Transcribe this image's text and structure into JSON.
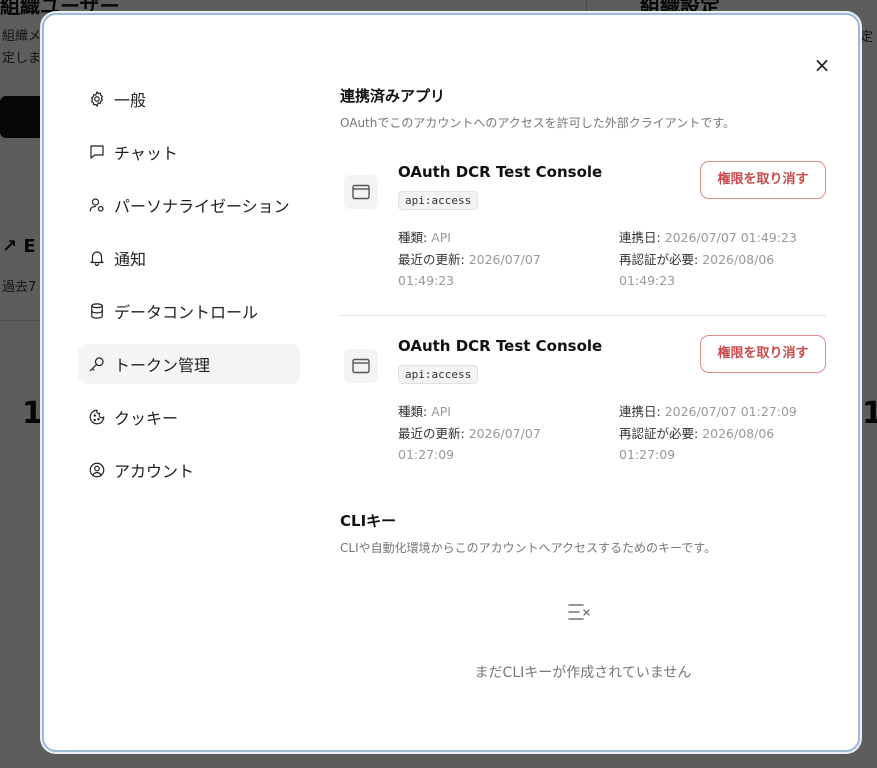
{
  "background": {
    "title_left": "組織ユーザー",
    "title_right": "組織設定",
    "desc_left_1": "組織メ",
    "desc_left_2": "定しま",
    "desc_right": "定",
    "section": "↗ E",
    "section_desc": "過去7",
    "number_left": "1",
    "number_right": "1"
  },
  "modal": {
    "close_label": "×",
    "sidebar": {
      "items": [
        {
          "label": "一般",
          "icon": "gear-icon"
        },
        {
          "label": "チャット",
          "icon": "chat-bubble-icon"
        },
        {
          "label": "パーソナライゼーション",
          "icon": "user-settings-icon"
        },
        {
          "label": "通知",
          "icon": "bell-icon"
        },
        {
          "label": "データコントロール",
          "icon": "database-icon"
        },
        {
          "label": "トークン管理",
          "icon": "key-icon"
        },
        {
          "label": "クッキー",
          "icon": "cookie-icon"
        },
        {
          "label": "アカウント",
          "icon": "account-circle-icon"
        }
      ],
      "active_index": 5
    },
    "connected_apps": {
      "title": "連携済みアプリ",
      "description": "OAuthでこのアカウントへのアクセスを許可した外部クライアントです。",
      "apps": [
        {
          "name": "OAuth DCR Test Console",
          "scope": "api:access",
          "revoke_label": "権限を取り消す",
          "type_label": "種類:",
          "type_value": "API",
          "linked_label": "連携日:",
          "linked_value": "2026/07/07 01:49:23",
          "updated_label": "最近の更新:",
          "updated_value": "2026/07/07 01:49:23",
          "reauth_label": "再認証が必要:",
          "reauth_value": "2026/08/06 01:49:23"
        },
        {
          "name": "OAuth DCR Test Console",
          "scope": "api:access",
          "revoke_label": "権限を取り消す",
          "type_label": "種類:",
          "type_value": "API",
          "linked_label": "連携日:",
          "linked_value": "2026/07/07 01:27:09",
          "updated_label": "最近の更新:",
          "updated_value": "2026/07/07 01:27:09",
          "reauth_label": "再認証が必要:",
          "reauth_value": "2026/08/06 01:27:09"
        }
      ]
    },
    "cli_keys": {
      "title": "CLIキー",
      "description": "CLIや自動化環境からこのアカウントへアクセスするためのキーです。",
      "empty_icon": "empty-list-icon",
      "empty_text": "まだCLIキーが作成されていません"
    }
  }
}
